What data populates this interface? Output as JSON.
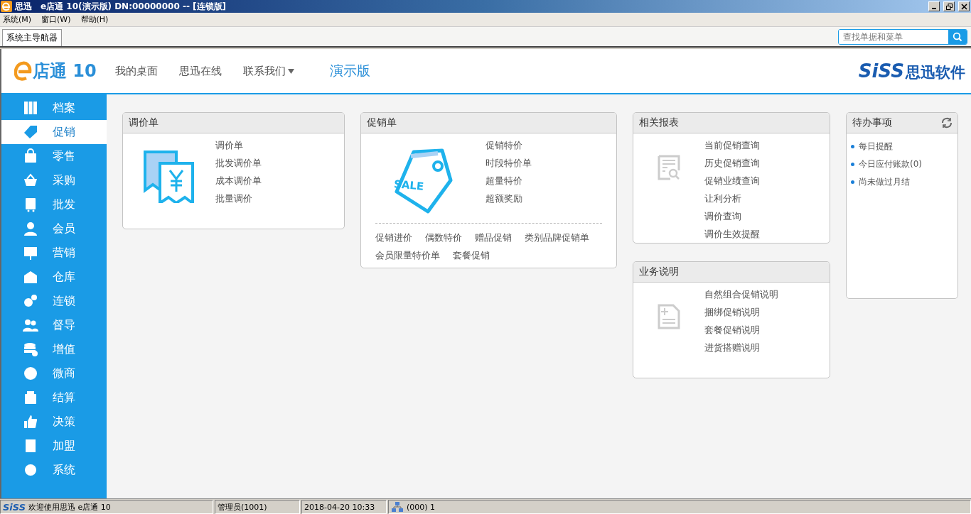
{
  "window": {
    "app_name": "思迅",
    "title": "e店通 10(演示版) DN:00000000 -- [连锁版]"
  },
  "menu": [
    "系统(M)",
    "窗口(W)",
    "帮助(H)"
  ],
  "tabs": [
    {
      "label": "系统主导航器",
      "selected": true
    }
  ],
  "search": {
    "placeholder": "查找单据和菜单"
  },
  "header": {
    "logo": "店通 10",
    "nav": [
      {
        "label": "我的桌面",
        "dropdown": false
      },
      {
        "label": "思迅在线",
        "dropdown": false
      },
      {
        "label": "联系我们",
        "dropdown": true
      }
    ],
    "edition": "演示版",
    "brand": "SiSS",
    "brand_cn": "思迅软件"
  },
  "sidebar": {
    "items": [
      {
        "label": "档案",
        "selected": false
      },
      {
        "label": "促销",
        "selected": true
      },
      {
        "label": "零售",
        "selected": false
      },
      {
        "label": "采购",
        "selected": false
      },
      {
        "label": "批发",
        "selected": false
      },
      {
        "label": "会员",
        "selected": false
      },
      {
        "label": "营销",
        "selected": false
      },
      {
        "label": "仓库",
        "selected": false
      },
      {
        "label": "连锁",
        "selected": false
      },
      {
        "label": "督导",
        "selected": false
      },
      {
        "label": "增值",
        "selected": false
      },
      {
        "label": "微商",
        "selected": false
      },
      {
        "label": "结算",
        "selected": false
      },
      {
        "label": "决策",
        "selected": false
      },
      {
        "label": "加盟",
        "selected": false
      },
      {
        "label": "系统",
        "selected": false
      }
    ]
  },
  "panels": {
    "price_adjust": {
      "title": "调价单",
      "links": [
        "调价单",
        "批发调价单",
        "成本调价单",
        "批量调价"
      ]
    },
    "promotion": {
      "title": "促销单",
      "icon_text": "SALE",
      "links": [
        "促销特价",
        "时段特价单",
        "超量特价",
        "超额奖励"
      ],
      "extra_links": [
        "促销进价",
        "偶数特价",
        "赠品促销",
        "类别品牌促销单",
        "会员限量特价单",
        "套餐促销"
      ]
    },
    "reports": {
      "title": "相关报表",
      "links": [
        "当前促销查询",
        "历史促销查询",
        "促销业绩查询",
        "让利分析",
        "调价查询",
        "调价生效提醒"
      ]
    },
    "docs": {
      "title": "业务说明",
      "links": [
        "自然组合促销说明",
        "捆绑促销说明",
        "套餐促销说明",
        "进货搭赠说明"
      ]
    },
    "todo": {
      "title": "待办事项",
      "items": [
        "每日提醒",
        "今日应付账款(0)",
        "尚未做过月结"
      ]
    }
  },
  "status_bar": {
    "logo": "SiSS",
    "welcome": "欢迎使用思迅 e店通 10",
    "user": "管理员(1001)",
    "datetime": "2018-04-20 10:33",
    "network": "(000) 1"
  }
}
